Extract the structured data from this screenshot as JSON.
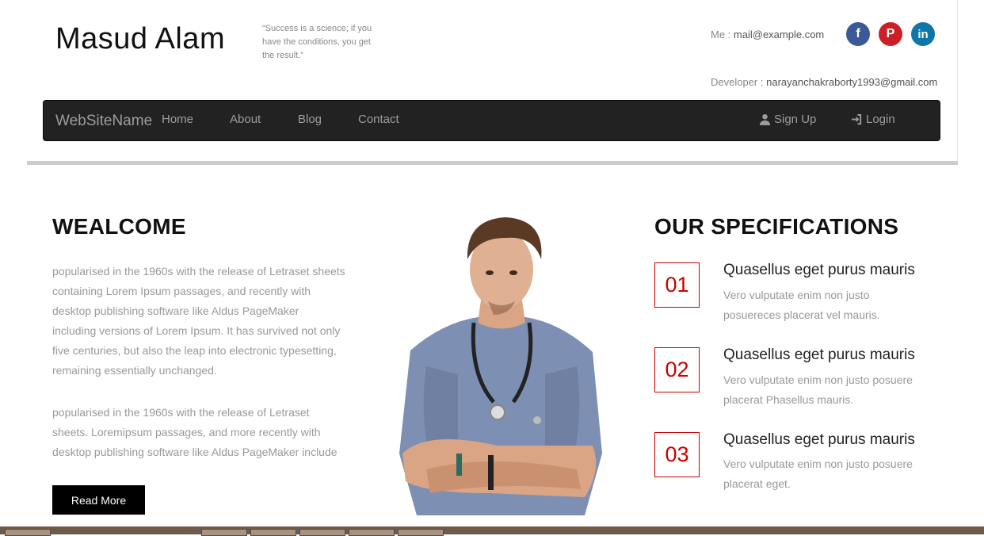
{
  "header": {
    "site_title": "Masud Alam",
    "quote": "“Success is a science; if you have the conditions, you get the result.”",
    "contact_me_label": "Me :",
    "contact_me_value": "mail@example.com",
    "contact_dev_label": "Developer :",
    "contact_dev_value": "narayanchakraborty1993@gmail.com",
    "social": {
      "facebook": "f",
      "pinterest": "P",
      "linkedin": "in"
    }
  },
  "nav": {
    "brand": "WebSiteName",
    "items": [
      "Home",
      "About",
      "Blog",
      "Contact"
    ],
    "signup": "Sign Up",
    "login": "Login"
  },
  "welcome": {
    "title": "WEALCOME",
    "para1": "popularised in the 1960s with the release of Letraset sheets containing Lorem Ipsum passages, and recently with desktop publishing software like Aldus PageMaker including versions of Lorem Ipsum. It has survived not only five centuries, but also the leap into electronic typesetting, remaining essentially unchanged.",
    "para2": "popularised in the 1960s with the release of Letraset sheets. Loremipsum passages, and more recently with desktop publishing software like Aldus PageMaker include",
    "button": "Read More"
  },
  "specs": {
    "title": "OUR SPECIFICATIONS",
    "items": [
      {
        "num": "01",
        "heading": "Quasellus eget purus mauris",
        "desc": "Vero vulputate enim non justo posuereces placerat vel mauris."
      },
      {
        "num": "02",
        "heading": "Quasellus eget purus mauris",
        "desc": "Vero vulputate enim non justo posuere placerat Phasellus mauris."
      },
      {
        "num": "03",
        "heading": "Quasellus eget purus mauris",
        "desc": "Vero vulputate enim non justo posuere placerat eget."
      }
    ]
  },
  "colors": {
    "accent": "#cc0000",
    "navbar": "#222222",
    "facebook": "#3b5998",
    "pinterest": "#cb2027",
    "linkedin": "#0e76a8"
  }
}
